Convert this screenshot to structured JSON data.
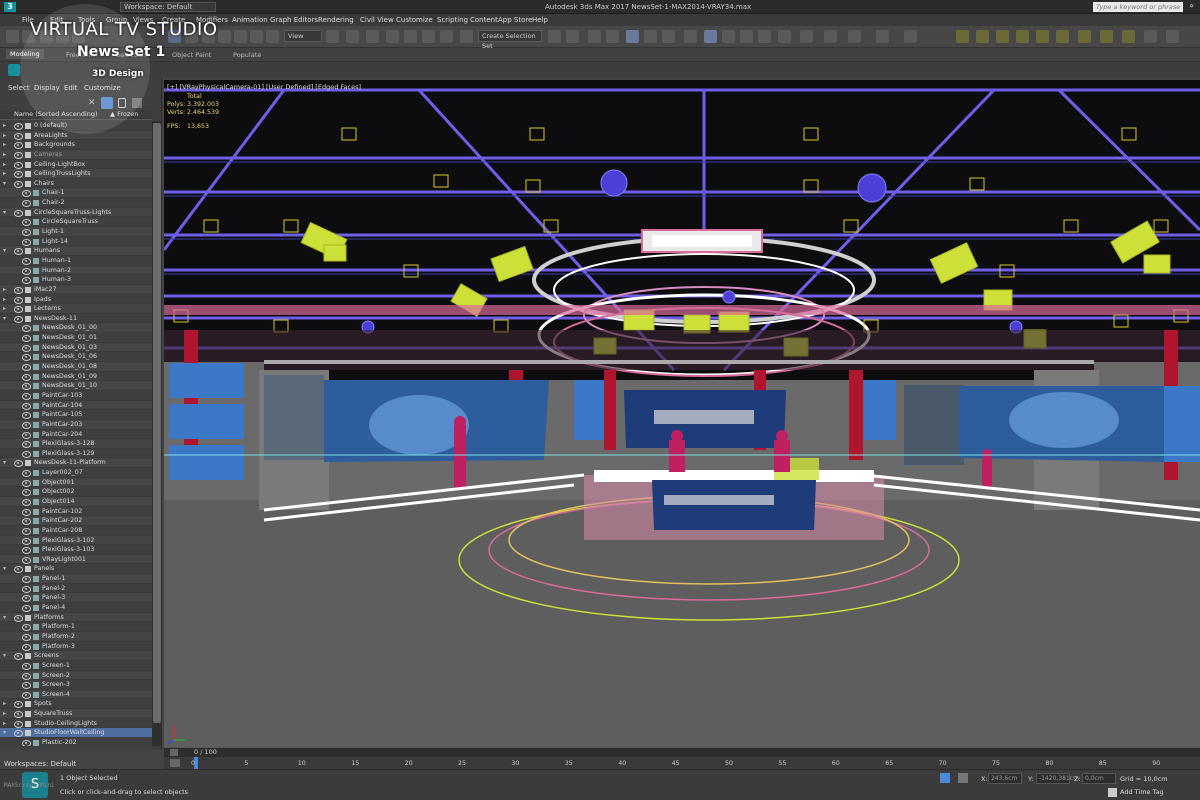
{
  "window": {
    "workspace_label": "Workspace: Default",
    "title": "Autodesk 3ds Max 2017     NewsSet-1-MAX2014-VRAY34.max",
    "search_placeholder": "Type a keyword or phrase"
  },
  "menu": [
    "File",
    "Edit",
    "Tools",
    "Group",
    "Views",
    "Create",
    "Modifiers",
    "Animation",
    "Graph Editors",
    "Rendering",
    "Civil View",
    "Customize",
    "Scripting",
    "Content",
    "App Store",
    "Help"
  ],
  "toolbar": {
    "view_dropdown": "View",
    "selection_set_dropdown": "Create Selection Set"
  },
  "ribbon_tabs": [
    "Modeling",
    "Freeform",
    "Selection",
    "Object Paint",
    "Populate"
  ],
  "overlay": {
    "title": "VIRTUAL TV STUDIO",
    "subtitle": "News Set 1",
    "tagline": "3D Design"
  },
  "scene_explorer": {
    "menu": [
      "Select",
      "Display",
      "Edit",
      "Customize"
    ],
    "col_name": "Name (Sorted Ascending)",
    "col_frozen": "▲ Frozen",
    "rows": [
      {
        "label": "0 (default)",
        "indent": 1,
        "type": "layer"
      },
      {
        "label": "AreaLights",
        "indent": 1,
        "type": "layer"
      },
      {
        "label": "Backgrounds",
        "indent": 1,
        "type": "layer"
      },
      {
        "label": "Cameras",
        "indent": 1,
        "type": "layer",
        "dim": true
      },
      {
        "label": "Ceiling-LightBox",
        "indent": 1,
        "type": "layer"
      },
      {
        "label": "CeilingTrussLights",
        "indent": 1,
        "type": "layer"
      },
      {
        "label": "Chairs",
        "indent": 1,
        "type": "layer",
        "open": true
      },
      {
        "label": "Chair-1",
        "indent": 2,
        "type": "obj"
      },
      {
        "label": "Chair-2",
        "indent": 2,
        "type": "obj"
      },
      {
        "label": "CircleSquareTruss-Lights",
        "indent": 1,
        "type": "layer",
        "open": true
      },
      {
        "label": "CircleSquareTruss",
        "indent": 2,
        "type": "obj"
      },
      {
        "label": "Light-1",
        "indent": 2,
        "type": "obj"
      },
      {
        "label": "Light-14",
        "indent": 2,
        "type": "obj"
      },
      {
        "label": "Humans",
        "indent": 1,
        "type": "layer",
        "open": true
      },
      {
        "label": "Human-1",
        "indent": 2,
        "type": "obj"
      },
      {
        "label": "Human-2",
        "indent": 2,
        "type": "obj"
      },
      {
        "label": "Human-3",
        "indent": 2,
        "type": "obj"
      },
      {
        "label": "iMac27",
        "indent": 1,
        "type": "layer"
      },
      {
        "label": "Ipads",
        "indent": 1,
        "type": "layer"
      },
      {
        "label": "Lecterns",
        "indent": 1,
        "type": "layer"
      },
      {
        "label": "NewsDesk-11",
        "indent": 1,
        "type": "layer",
        "open": true
      },
      {
        "label": "NewsDesk_01_00",
        "indent": 2,
        "type": "obj"
      },
      {
        "label": "NewsDesk_01_01",
        "indent": 2,
        "type": "obj"
      },
      {
        "label": "NewsDesk_01_03",
        "indent": 2,
        "type": "obj"
      },
      {
        "label": "NewsDesk_01_06",
        "indent": 2,
        "type": "obj"
      },
      {
        "label": "NewsDesk_01_08",
        "indent": 2,
        "type": "obj"
      },
      {
        "label": "NewsDesk_01_09",
        "indent": 2,
        "type": "obj"
      },
      {
        "label": "NewsDesk_01_10",
        "indent": 2,
        "type": "obj"
      },
      {
        "label": "PaintCar-103",
        "indent": 2,
        "type": "obj"
      },
      {
        "label": "PaintCar-104",
        "indent": 2,
        "type": "obj"
      },
      {
        "label": "PaintCar-105",
        "indent": 2,
        "type": "obj"
      },
      {
        "label": "PaintCar-203",
        "indent": 2,
        "type": "obj"
      },
      {
        "label": "PaintCar-204",
        "indent": 2,
        "type": "obj"
      },
      {
        "label": "PlexiGlass-3-128",
        "indent": 2,
        "type": "obj"
      },
      {
        "label": "PlexiGlass-3-129",
        "indent": 2,
        "type": "obj"
      },
      {
        "label": "NewsDesk-11-Platform",
        "indent": 1,
        "type": "layer",
        "open": true
      },
      {
        "label": "Layer002_07",
        "indent": 2,
        "type": "obj"
      },
      {
        "label": "Object001",
        "indent": 2,
        "type": "obj"
      },
      {
        "label": "Object002",
        "indent": 2,
        "type": "obj"
      },
      {
        "label": "Object014",
        "indent": 2,
        "type": "obj"
      },
      {
        "label": "PaintCar-102",
        "indent": 2,
        "type": "obj"
      },
      {
        "label": "PaintCar-202",
        "indent": 2,
        "type": "obj"
      },
      {
        "label": "PaintCar-208",
        "indent": 2,
        "type": "obj"
      },
      {
        "label": "PlexiGlass-3-102",
        "indent": 2,
        "type": "obj"
      },
      {
        "label": "PlexiGlass-3-103",
        "indent": 2,
        "type": "obj"
      },
      {
        "label": "VRayLight001",
        "indent": 2,
        "type": "obj"
      },
      {
        "label": "Panels",
        "indent": 1,
        "type": "layer",
        "open": true
      },
      {
        "label": "Panel-1",
        "indent": 2,
        "type": "obj"
      },
      {
        "label": "Panel-2",
        "indent": 2,
        "type": "obj"
      },
      {
        "label": "Panel-3",
        "indent": 2,
        "type": "obj"
      },
      {
        "label": "Panel-4",
        "indent": 2,
        "type": "obj"
      },
      {
        "label": "Platforms",
        "indent": 1,
        "type": "layer",
        "open": true
      },
      {
        "label": "Platform-1",
        "indent": 2,
        "type": "obj"
      },
      {
        "label": "Platform-2",
        "indent": 2,
        "type": "obj"
      },
      {
        "label": "Platform-3",
        "indent": 2,
        "type": "obj"
      },
      {
        "label": "Screens",
        "indent": 1,
        "type": "layer",
        "open": true
      },
      {
        "label": "Screen-1",
        "indent": 2,
        "type": "obj"
      },
      {
        "label": "Screen-2",
        "indent": 2,
        "type": "obj"
      },
      {
        "label": "Screen-3",
        "indent": 2,
        "type": "obj"
      },
      {
        "label": "Screen-4",
        "indent": 2,
        "type": "obj"
      },
      {
        "label": "Spots",
        "indent": 1,
        "type": "layer"
      },
      {
        "label": "SquareTruss",
        "indent": 1,
        "type": "layer"
      },
      {
        "label": "Studio-CeilingLights",
        "indent": 1,
        "type": "layer"
      },
      {
        "label": "StudioFloorWallCeiling",
        "indent": 1,
        "type": "layer",
        "sel": true,
        "open": true
      },
      {
        "label": "Plastic-202",
        "indent": 2,
        "type": "obj"
      }
    ]
  },
  "viewport": {
    "label": "[+] [VRayPhysicalCamera-01] [User Defined] [Edged Faces]",
    "stats_header": "Total",
    "polys_label": "Polys:",
    "polys_value": "3.392.003",
    "verts_label": "Verts:",
    "verts_value": "2.464.539",
    "fps_label": "FPS:",
    "fps_value": "13,653"
  },
  "timeline": {
    "frame": "0 / 100",
    "ticks": [
      "0",
      "5",
      "10",
      "15",
      "20",
      "25",
      "30",
      "35",
      "40",
      "45",
      "50",
      "55",
      "60",
      "65",
      "70",
      "75",
      "80",
      "85",
      "90"
    ]
  },
  "status": {
    "workspace": "Workspaces: Default",
    "selected": "1 Object Selected",
    "hint": "Click or click-and-drag to select objects",
    "x_label": "X:",
    "x_value": "243,6cm",
    "y_label": "Y:",
    "y_value": "-1420,381cm",
    "z_label": "Z:",
    "z_value": "0,0cm",
    "grid": "Grid = 10,0cm",
    "add_time_tag": "Add Time Tag",
    "maxscript": "MAXScript Mini"
  },
  "colors": {
    "accent": "#1a8f9e",
    "truss": "#6f5ee8",
    "lights": "#cde03a",
    "pink": "#d86b9a",
    "screen": "#3b78c8"
  }
}
